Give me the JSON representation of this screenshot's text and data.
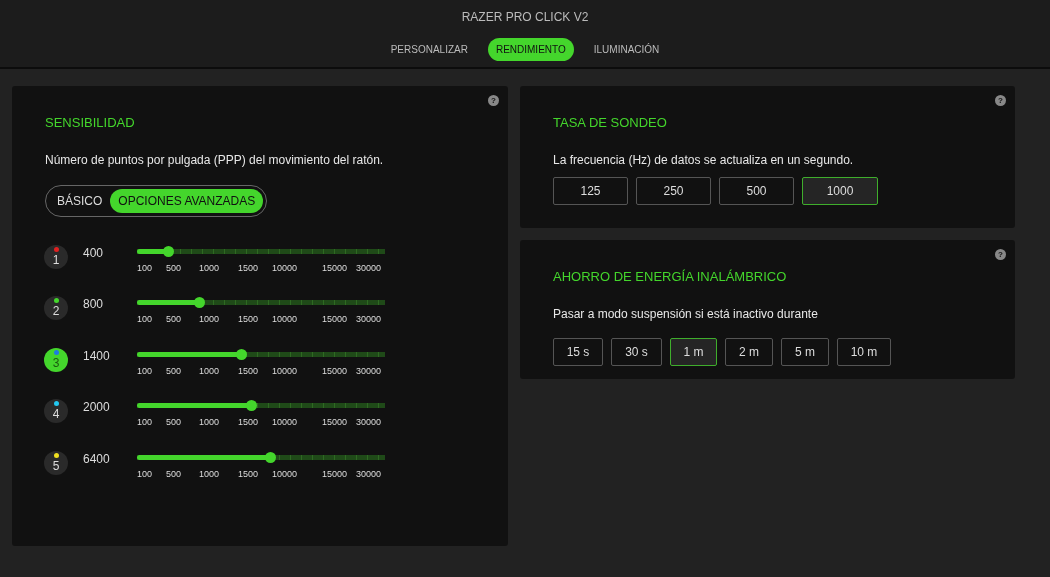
{
  "window": {
    "title": "RAZER PRO CLICK V2"
  },
  "tabs": [
    {
      "label": "PERSONALIZAR",
      "selected": false
    },
    {
      "label": "RENDIMIENTO",
      "selected": true
    },
    {
      "label": "ILUMINACIÓN",
      "selected": false
    }
  ],
  "sensitivity": {
    "help": "?",
    "title": "SENSIBILIDAD",
    "description": "Número de puntos por pulgada (PPP) del movimiento del ratón.",
    "modes": [
      {
        "label": "BÁSICO",
        "selected": false
      },
      {
        "label": "OPCIONES AVANZADAS",
        "selected": true
      }
    ],
    "stages": [
      {
        "number": "1",
        "color": "#e02020",
        "selected": false,
        "value": "400",
        "level": 0.125,
        "scale_labels": [
          "100",
          "500",
          "1000",
          "1500",
          "10000",
          "15000",
          "30000"
        ]
      },
      {
        "number": "2",
        "color": "#44d62c",
        "selected": false,
        "value": "800",
        "level": 0.25,
        "scale_labels": [
          "100",
          "500",
          "1000",
          "1500",
          "10000",
          "15000",
          "30000"
        ]
      },
      {
        "number": "3",
        "color": "#1e7be0",
        "selected": true,
        "value": "1400",
        "level": 0.42,
        "scale_labels": [
          "100",
          "500",
          "1000",
          "1500",
          "10000",
          "15000",
          "30000"
        ]
      },
      {
        "number": "4",
        "color": "#22c8f0",
        "selected": false,
        "value": "2000",
        "level": 0.46,
        "scale_labels": [
          "100",
          "500",
          "1000",
          "1500",
          "10000",
          "15000",
          "30000"
        ]
      },
      {
        "number": "5",
        "color": "#f0e020",
        "selected": false,
        "value": "6400",
        "level": 0.535,
        "scale_labels": [
          "100",
          "500",
          "1000",
          "1500",
          "10000",
          "15000",
          "30000"
        ]
      }
    ]
  },
  "polling_rate": {
    "help": "?",
    "title": "TASA DE SONDEO",
    "description": "La frecuencia (Hz) de datos se actualiza en un segundo.",
    "options": [
      {
        "label": "125",
        "selected": false
      },
      {
        "label": "250",
        "selected": false
      },
      {
        "label": "500",
        "selected": false
      },
      {
        "label": "1000",
        "selected": true
      }
    ]
  },
  "power_saving": {
    "help": "?",
    "title": "AHORRO DE ENERGÍA INALÁMBRICO",
    "description": "Pasar a modo suspensión si está inactivo durante",
    "options": [
      {
        "label": "15 s",
        "selected": false
      },
      {
        "label": "30 s",
        "selected": false
      },
      {
        "label": "1 m",
        "selected": true
      },
      {
        "label": "2 m",
        "selected": false
      },
      {
        "label": "5 m",
        "selected": false
      },
      {
        "label": "10 m",
        "selected": false
      }
    ]
  }
}
